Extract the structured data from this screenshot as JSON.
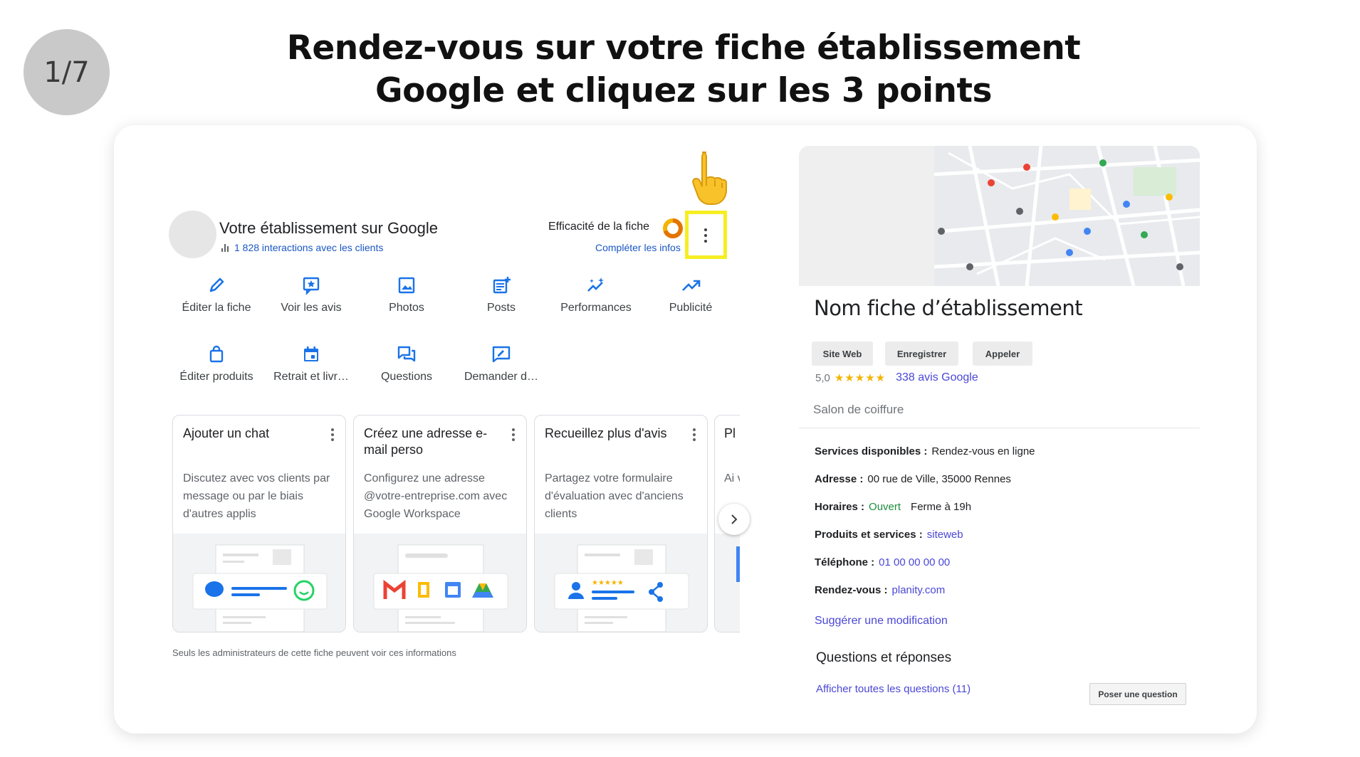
{
  "step": "1/7",
  "headline": {
    "line1": "Rendez-vous sur votre fiche établissement",
    "line2": "Google et cliquez sur les 3 points"
  },
  "business_panel": {
    "title": "Votre établissement sur Google",
    "interactions": "1 828 interactions avec les clients",
    "efficacy_label": "Efficacité de la fiche",
    "complete_link": "Compléter les infos",
    "actions": [
      {
        "label": "Éditer la fiche",
        "icon": "pencil-icon"
      },
      {
        "label": "Voir les avis",
        "icon": "review-star-icon"
      },
      {
        "label": "Photos",
        "icon": "image-icon"
      },
      {
        "label": "Posts",
        "icon": "post-add-icon"
      },
      {
        "label": "Performances",
        "icon": "sparkle-trend-icon"
      },
      {
        "label": "Publicité",
        "icon": "trending-up-icon"
      },
      {
        "label": "Éditer produits",
        "icon": "shopping-bag-icon"
      },
      {
        "label": "Retrait et livr…",
        "icon": "calendar-icon"
      },
      {
        "label": "Questions",
        "icon": "chat-bubbles-icon"
      },
      {
        "label": "Demander d…",
        "icon": "rate-review-icon"
      }
    ],
    "promos": [
      {
        "title": "Ajouter un chat",
        "desc": "Discutez avec vos clients par message ou par le biais d'autres applis"
      },
      {
        "title": "Créez une adresse e-mail perso",
        "desc": "Configurez une adresse @votre-entreprise.com avec Google Workspace"
      },
      {
        "title": "Recueillez plus d'avis",
        "desc": "Partagez votre formulaire d'évaluation avec d'anciens clients"
      }
    ],
    "promo_partial": {
      "title": "Pl l'e",
      "desc": "Ai vo"
    },
    "admin_note": "Seuls les administrateurs de cette fiche peuvent voir ces informations"
  },
  "place_panel": {
    "name": "Nom fiche d’établissement",
    "buttons": [
      "Site Web",
      "Enregistrer",
      "Appeler"
    ],
    "rating": "5,0",
    "stars": "★★★★★",
    "reviews": "338 avis Google",
    "category": "Salon de coiffure",
    "services": {
      "label": "Services disponibles :",
      "value": "Rendez-vous en ligne"
    },
    "address": {
      "label": "Adresse :",
      "value": "00 rue de Ville, 35000 Rennes"
    },
    "hours": {
      "label": "Horaires :",
      "status": "Ouvert",
      "value": "Ferme à 19h"
    },
    "products": {
      "label": "Produits et services :",
      "value": "siteweb"
    },
    "phone": {
      "label": "Téléphone :",
      "value": "01 00 00 00 00"
    },
    "booking": {
      "label": "Rendez-vous :",
      "value": "planity.com"
    },
    "suggest": "Suggérer une modification",
    "qa_title": "Questions et réponses",
    "qa_link": "Afficher toutes les questions (11)",
    "ask_button": "Poser une question"
  },
  "colors": {
    "highlight": "#f6ee23",
    "link": "#1a56c4",
    "accent_purple": "#4b47d6",
    "stars": "#f4b400",
    "open_green": "#1e8e3e"
  }
}
